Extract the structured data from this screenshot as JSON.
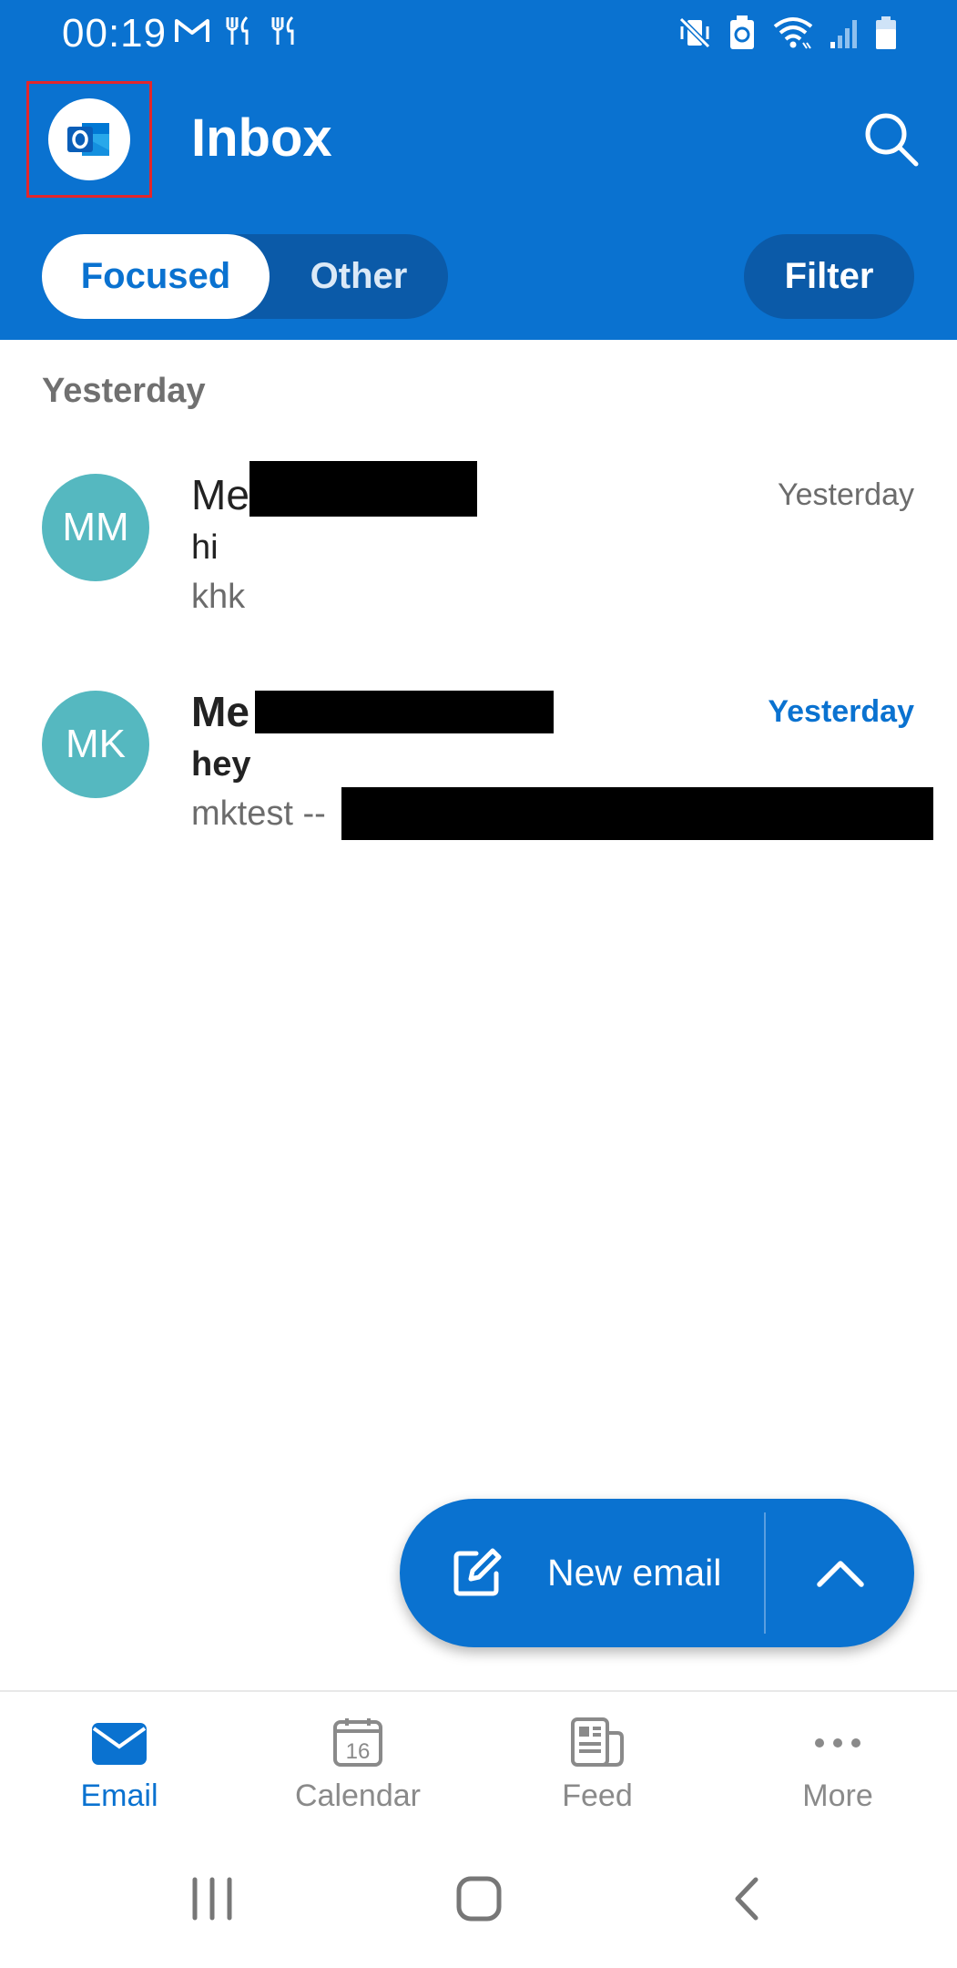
{
  "status_bar": {
    "time": "00:19",
    "left_icons": [
      "gmail-icon",
      "restaurant-icon",
      "restaurant-icon"
    ],
    "right_icons": [
      "mute-vibrate-icon",
      "battery-saver-icon",
      "wifi-icon",
      "signal-icon",
      "battery-icon"
    ]
  },
  "header": {
    "app_icon": "outlook-icon",
    "title": "Inbox",
    "search_icon": "search-icon",
    "tabs": [
      {
        "label": "Focused",
        "selected": true
      },
      {
        "label": "Other",
        "selected": false
      }
    ],
    "filter_label": "Filter"
  },
  "list": {
    "section_header": "Yesterday",
    "emails": [
      {
        "initials": "MM",
        "sender_visible": "Me",
        "time": "Yesterday",
        "subject": "hi",
        "preview": "khk",
        "unread": false
      },
      {
        "initials": "MK",
        "sender_visible": "Me",
        "time": "Yesterday",
        "subject": "hey",
        "preview": "mktest --",
        "unread": true
      }
    ]
  },
  "fab": {
    "label": "New email",
    "compose_icon": "compose-icon",
    "expand_icon": "chevron-up-icon"
  },
  "bottom_nav": [
    {
      "label": "Email",
      "icon": "mail-icon",
      "active": true
    },
    {
      "label": "Calendar",
      "icon": "calendar-icon",
      "badge": "16",
      "active": false
    },
    {
      "label": "Feed",
      "icon": "feed-icon",
      "active": false
    },
    {
      "label": "More",
      "icon": "more-icon",
      "active": false
    }
  ],
  "colors": {
    "brand": "#0a72d0",
    "avatar": "#55b8c0",
    "tab_track": "#0b5aa8"
  }
}
